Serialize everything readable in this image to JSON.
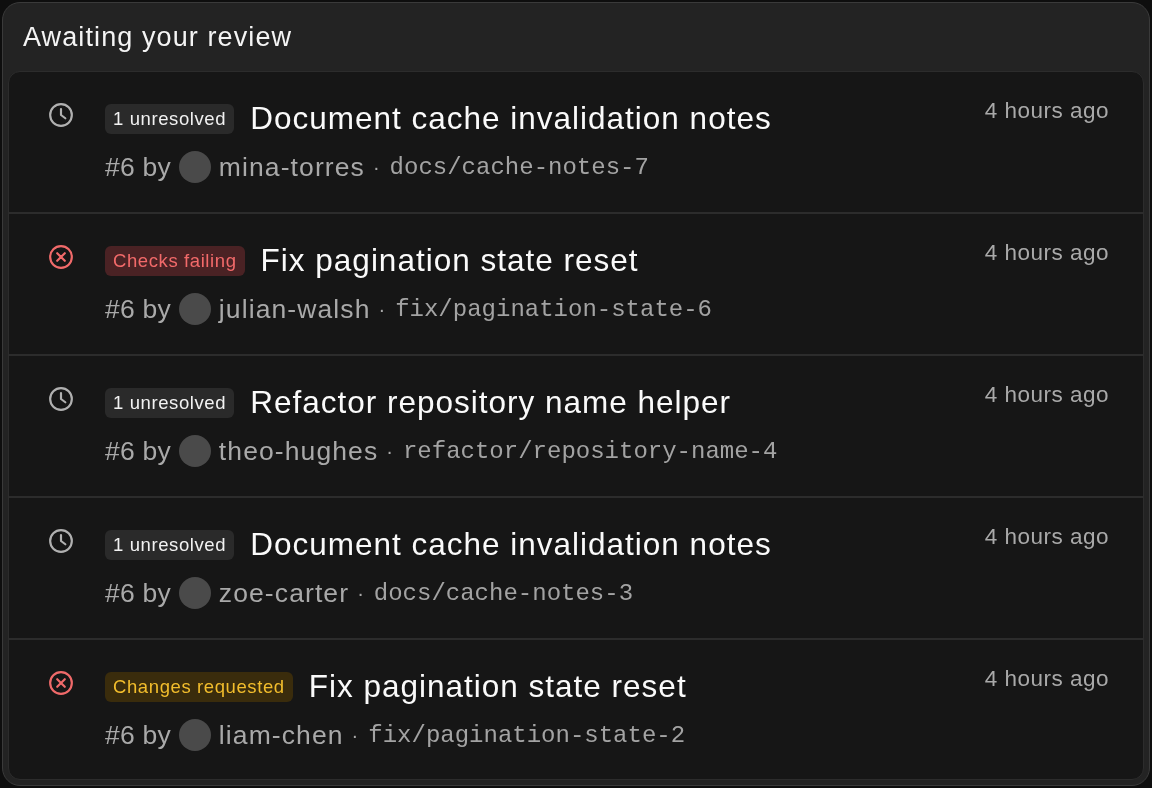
{
  "panel": {
    "title": "Awaiting your review"
  },
  "pull_requests": [
    {
      "kind": "pending",
      "badge": {
        "kind": "neutral",
        "label": "1 unresolved"
      },
      "title": "Document cache invalidation notes",
      "number": "#6 by",
      "author": "mina-torres",
      "separator": "·",
      "branch": "docs/cache-notes-7",
      "time": "4 hours ago"
    },
    {
      "kind": "failing",
      "badge": {
        "kind": "danger",
        "label": "Checks failing"
      },
      "title": "Fix pagination state reset",
      "number": "#6 by",
      "author": "julian-walsh",
      "separator": "·",
      "branch": "fix/pagination-state-6",
      "time": "4 hours ago"
    },
    {
      "kind": "pending",
      "badge": {
        "kind": "neutral",
        "label": "1 unresolved"
      },
      "title": "Refactor repository name helper",
      "number": "#6 by",
      "author": "theo-hughes",
      "separator": "·",
      "branch": "refactor/repository-name-4",
      "time": "4 hours ago"
    },
    {
      "kind": "pending",
      "badge": {
        "kind": "neutral",
        "label": "1 unresolved"
      },
      "title": "Document cache invalidation notes",
      "number": "#6 by",
      "author": "zoe-carter",
      "separator": "·",
      "branch": "docs/cache-notes-3",
      "time": "4 hours ago"
    },
    {
      "kind": "failing",
      "badge": {
        "kind": "warning",
        "label": "Changes requested"
      },
      "title": "Fix pagination state reset",
      "number": "#6 by",
      "author": "liam-chen",
      "separator": "·",
      "branch": "fix/pagination-state-2",
      "time": "4 hours ago"
    }
  ]
}
